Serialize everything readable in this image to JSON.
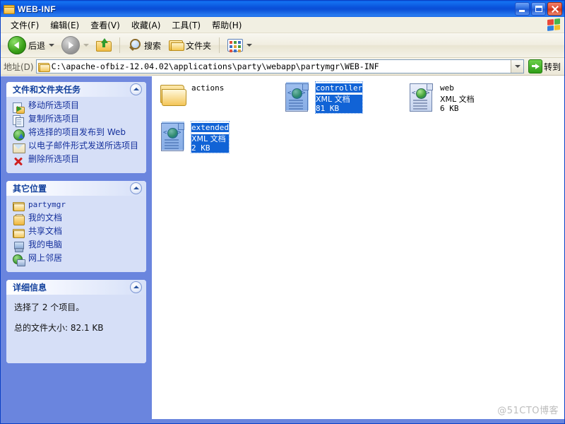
{
  "window": {
    "title": "WEB-INF",
    "title_icon": "folder-icon",
    "controls": {
      "minimize": "minimize-button",
      "maximize": "maximize-button",
      "close": "close-button"
    }
  },
  "menubar": {
    "items": [
      {
        "label": "文件(F)",
        "name": "menu-file"
      },
      {
        "label": "编辑(E)",
        "name": "menu-edit"
      },
      {
        "label": "查看(V)",
        "name": "menu-view"
      },
      {
        "label": "收藏(A)",
        "name": "menu-favorites"
      },
      {
        "label": "工具(T)",
        "name": "menu-tools"
      },
      {
        "label": "帮助(H)",
        "name": "menu-help"
      }
    ],
    "logo": "windows-flag-icon"
  },
  "toolbar": {
    "back_label": "后退",
    "forward_label": "",
    "up_label": "",
    "search_label": "搜索",
    "folders_label": "文件夹",
    "views_label": ""
  },
  "address": {
    "label": "地址(D)",
    "value": "C:\\apache-ofbiz-12.04.02\\applications\\party\\webapp\\partymgr\\WEB-INF",
    "go_label": "转到"
  },
  "sidebar": {
    "panels": [
      {
        "title": "文件和文件夹任务",
        "name": "panel-file-folder-tasks",
        "items": [
          {
            "label": "移动所选项目",
            "icon": "move-items-icon"
          },
          {
            "label": "复制所选项目",
            "icon": "copy-items-icon"
          },
          {
            "label": "将选择的项目发布到 Web",
            "icon": "publish-web-icon"
          },
          {
            "label": "以电子邮件形式发送所选项目",
            "icon": "email-items-icon"
          },
          {
            "label": "删除所选项目",
            "icon": "delete-items-icon"
          }
        ]
      },
      {
        "title": "其它位置",
        "name": "panel-other-places",
        "items": [
          {
            "label": "partymgr",
            "icon": "folder-icon",
            "mono": true
          },
          {
            "label": "我的文档",
            "icon": "my-documents-icon"
          },
          {
            "label": "共享文档",
            "icon": "shared-documents-icon"
          },
          {
            "label": "我的电脑",
            "icon": "my-computer-icon"
          },
          {
            "label": "网上邻居",
            "icon": "network-places-icon"
          }
        ]
      },
      {
        "title": "详细信息",
        "name": "panel-details",
        "lines": [
          "选择了 2 个项目。",
          "总的文件大小: 82.1 KB"
        ]
      }
    ]
  },
  "files": [
    {
      "name": "actions",
      "type": "",
      "size": "",
      "icon": "folder-icon",
      "selected": false
    },
    {
      "name": "controller",
      "type": "XML 文档",
      "size": "81 KB",
      "icon": "xml-document-icon",
      "selected": true
    },
    {
      "name": "web",
      "type": "XML 文档",
      "size": "6 KB",
      "icon": "xml-document-icon",
      "selected": false
    },
    {
      "name": "extended",
      "type": "XML 文档",
      "size": "2 KB",
      "icon": "xml-document-icon",
      "selected": true
    }
  ],
  "watermark": "@51CTO博客",
  "colors": {
    "title_blue": "#0a4ed6",
    "sidebar_blue": "#6a85de",
    "panel_body": "#d6dff7",
    "panel_title_text": "#12409c",
    "selection_blue": "#1163d6"
  }
}
